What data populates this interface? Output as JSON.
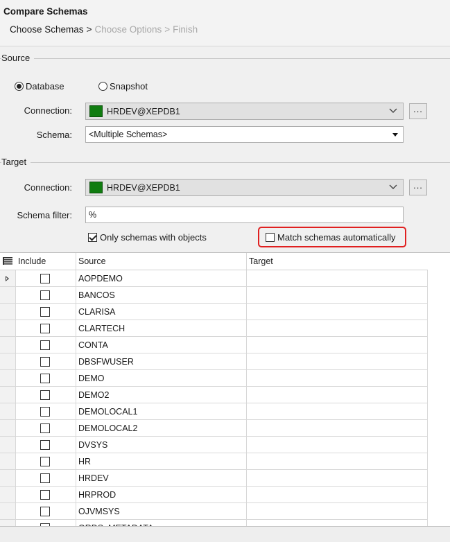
{
  "header": {
    "title": "Compare Schemas",
    "breadcrumbs": [
      {
        "label": "Choose Schemas",
        "active": true
      },
      {
        "label": "Choose Options",
        "active": false
      },
      {
        "label": "Finish",
        "active": false
      }
    ],
    "separator": ">"
  },
  "source": {
    "section_label": "Source",
    "radio_database": "Database",
    "radio_snapshot": "Snapshot",
    "selected": "Database",
    "connection_label": "Connection:",
    "connection_value": "HRDEV@XEPDB1",
    "connection_color": "#107c10",
    "schema_label": "Schema:",
    "schema_value": "<Multiple Schemas>",
    "browse_label": "..."
  },
  "target": {
    "section_label": "Target",
    "connection_label": "Connection:",
    "connection_value": "HRDEV@XEPDB1",
    "connection_color": "#107c10",
    "browse_label": "...",
    "schema_filter_label": "Schema filter:",
    "schema_filter_value": "%",
    "only_schemas_label": "Only schemas with objects",
    "only_schemas_checked": true,
    "match_auto_label": "Match schemas automatically",
    "match_auto_checked": false
  },
  "grid": {
    "columns": {
      "include": "Include",
      "source": "Source",
      "target": "Target"
    },
    "rows": [
      {
        "source": "AOPDEMO",
        "target": "",
        "include": false,
        "current": true
      },
      {
        "source": "BANCOS",
        "target": "",
        "include": false
      },
      {
        "source": "CLARISA",
        "target": "",
        "include": false
      },
      {
        "source": "CLARTECH",
        "target": "",
        "include": false
      },
      {
        "source": "CONTA",
        "target": "",
        "include": false
      },
      {
        "source": "DBSFWUSER",
        "target": "",
        "include": false
      },
      {
        "source": "DEMO",
        "target": "",
        "include": false
      },
      {
        "source": "DEMO2",
        "target": "",
        "include": false
      },
      {
        "source": "DEMOLOCAL1",
        "target": "",
        "include": false
      },
      {
        "source": "DEMOLOCAL2",
        "target": "",
        "include": false
      },
      {
        "source": "DVSYS",
        "target": "",
        "include": false
      },
      {
        "source": "HR",
        "target": "",
        "include": false
      },
      {
        "source": "HRDEV",
        "target": "",
        "include": false
      },
      {
        "source": "HRPROD",
        "target": "",
        "include": false
      },
      {
        "source": "OJVMSYS",
        "target": "",
        "include": false
      },
      {
        "source": "ORDS_METADATA",
        "target": "",
        "include": false
      }
    ]
  },
  "icons": {
    "grid_menu": "list-icon",
    "row_indicator": "current-row-arrow-icon",
    "dropdown": "chevron-down-icon"
  }
}
